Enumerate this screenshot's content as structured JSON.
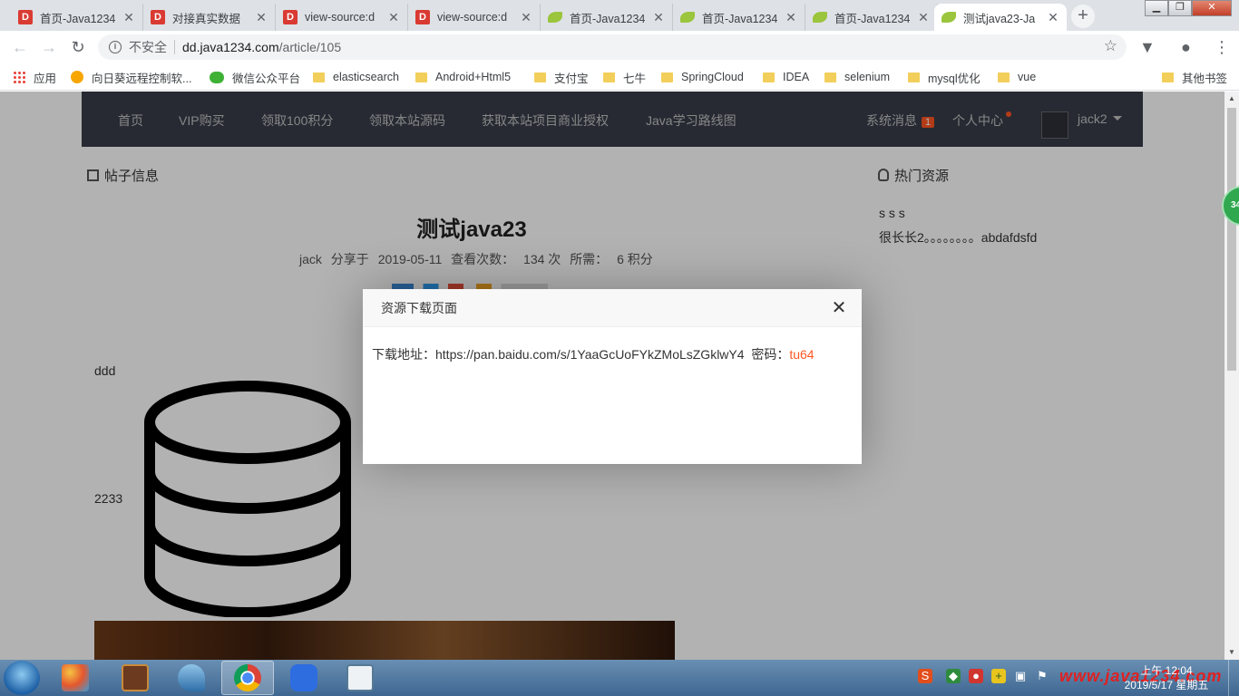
{
  "browser": {
    "tabs": [
      {
        "title": "首页-Java1234",
        "icon": "d-favicon"
      },
      {
        "title": "对接真实数据",
        "icon": "d-favicon"
      },
      {
        "title": "view-source:d",
        "icon": "d-favicon"
      },
      {
        "title": "view-source:d",
        "icon": "d-favicon"
      },
      {
        "title": "首页-Java1234",
        "icon": "leaf-favicon"
      },
      {
        "title": "首页-Java1234",
        "icon": "leaf-favicon"
      },
      {
        "title": "首页-Java1234",
        "icon": "leaf-favicon"
      },
      {
        "title": "测试java23-Ja",
        "icon": "leaf-favicon",
        "active": true
      }
    ],
    "new_tab": "+",
    "security_label": "不安全",
    "url_host": "dd.java1234.com",
    "url_path": "/article/105"
  },
  "bookmarks": [
    {
      "label": "应用",
      "icon": "apps-icon"
    },
    {
      "label": "向日葵远程控制软...",
      "icon": "sunflower-icon"
    },
    {
      "label": "微信公众平台",
      "icon": "wechat-icon"
    },
    {
      "label": "elasticsearch",
      "icon": "folder-icon"
    },
    {
      "label": "Android+Html5",
      "icon": "folder-icon"
    },
    {
      "label": "支付宝",
      "icon": "folder-icon"
    },
    {
      "label": "七牛",
      "icon": "folder-icon"
    },
    {
      "label": "SpringCloud",
      "icon": "folder-icon"
    },
    {
      "label": "IDEA",
      "icon": "folder-icon"
    },
    {
      "label": "selenium",
      "icon": "folder-icon"
    },
    {
      "label": "mysql优化",
      "icon": "folder-icon"
    },
    {
      "label": "vue",
      "icon": "folder-icon"
    },
    {
      "label": "其他书签",
      "icon": "folder-icon"
    }
  ],
  "site_nav": {
    "links": [
      "首页",
      "VIP购买",
      "领取100积分",
      "领取本站源码",
      "获取本站项目商业授权",
      "Java学习路线图"
    ],
    "messages_label": "系统消息",
    "messages_count": "1",
    "user_center": "个人中心",
    "username": "jack2"
  },
  "article": {
    "section_title": "帖子信息",
    "title": "测试java23",
    "author": "jack",
    "shared_on_label": "分享于",
    "date": "2019-05-11",
    "views_label": "查看次数：",
    "views": "134 次",
    "cost_label": "所需：",
    "cost": "6 积分",
    "body_lines": [
      "ddd",
      "2233"
    ]
  },
  "hot_resources": {
    "title": "热门资源",
    "items": [
      "s s s",
      "很长长2。。。。。。。。abdafdsfd"
    ]
  },
  "modal": {
    "title": "资源下载页面",
    "download_label": "下载地址：",
    "download_url": "https://pan.baidu.com/s/1YaaGcUoFYkZMoLsZGklwY4",
    "password_label": "密码：",
    "password": "tu64"
  },
  "floating_badge": "34",
  "taskbar": {
    "watermark": "www.java1234.com",
    "time": "上午 12:04",
    "date": "2019/5/17 星期五"
  },
  "colors": {
    "site_nav_bg": "#393d49",
    "accent": "#ff5722",
    "tab_strip": "#dee1e6"
  }
}
